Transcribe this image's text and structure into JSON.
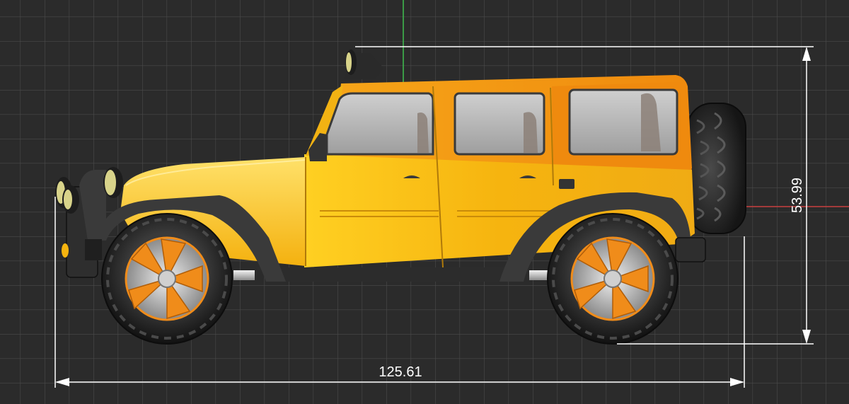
{
  "viewport": {
    "background": "#2b2b2b",
    "grid_color": "#4a4a4a",
    "axis_y_color": "#3fbf4f",
    "axis_x_color": "#c94040"
  },
  "model": {
    "object": "jeep-suv",
    "body_color": "#f5b514",
    "roof_color": "#f08c10",
    "wheel_color": "#f08c1a",
    "tire_color": "#2e2e2e"
  },
  "dimensions": {
    "length_label": "125.61",
    "height_label": "53.99",
    "line_color": "#ffffff"
  }
}
